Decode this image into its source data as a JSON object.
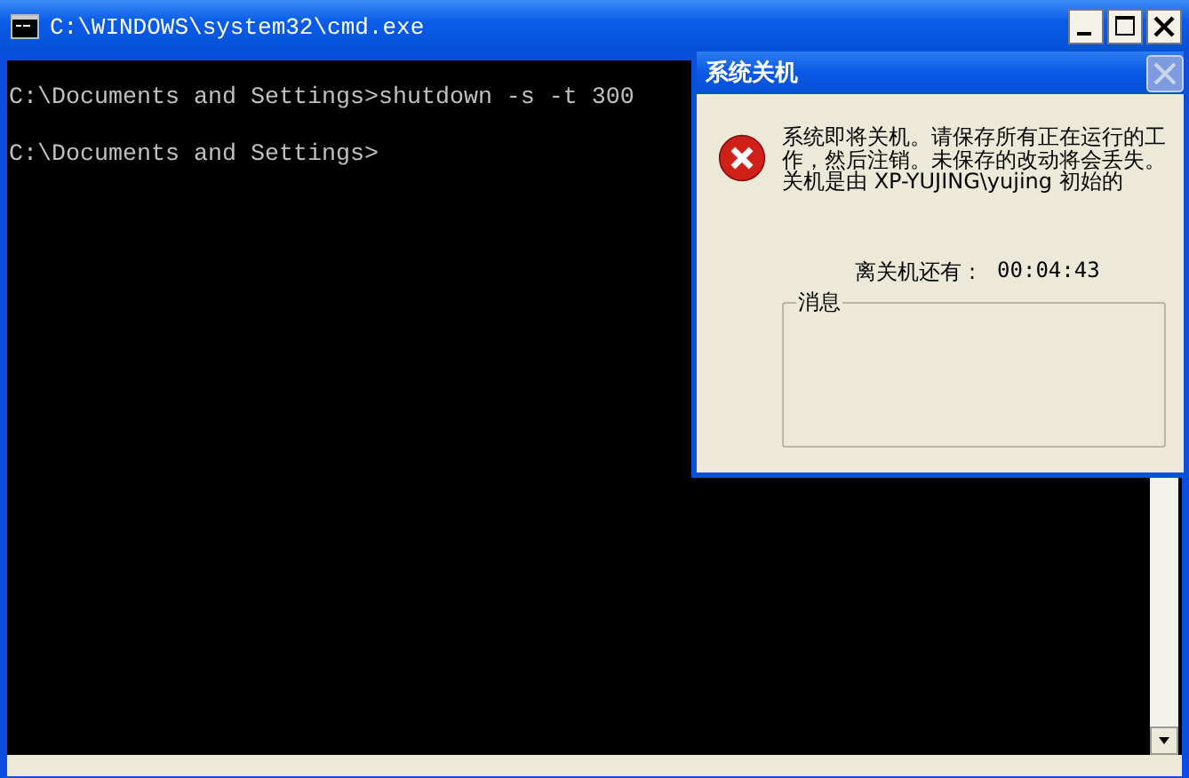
{
  "console_window": {
    "title": "C:\\WINDOWS\\system32\\cmd.exe",
    "lines": [
      "C:\\Documents and Settings>shutdown -s -t 300",
      "C:\\Documents and Settings>"
    ]
  },
  "shutdown_dialog": {
    "title": "系统关机",
    "message_lines": [
      "系统即将关机。请保存所有正在运行的工",
      "作，然后注销。未保存的改动将会丢失。",
      "关机是由 XP-YUJING\\yujing 初始的"
    ],
    "countdown_label": "离关机还有 :",
    "countdown_value": "00:04:43",
    "group_label": "消息"
  }
}
